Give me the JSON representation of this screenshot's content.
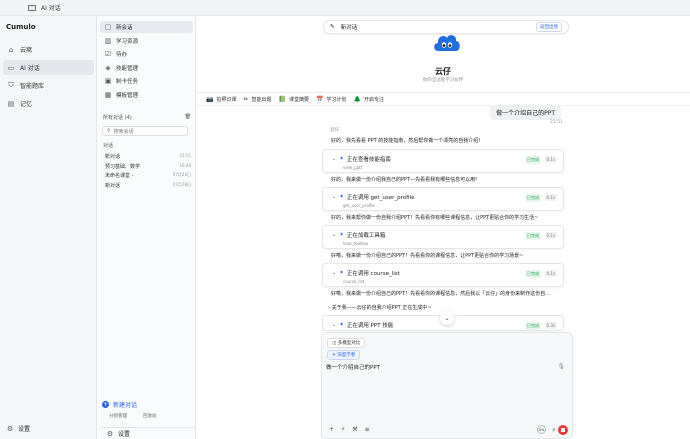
{
  "window": {
    "title": "AI 对话"
  },
  "nav": {
    "brand": "Cumulo",
    "items": [
      {
        "label": "云窝",
        "icon": "home-icon"
      },
      {
        "label": "AI 对话",
        "icon": "chat-icon"
      },
      {
        "label": "智能题库",
        "icon": "cap-icon"
      },
      {
        "label": "记忆",
        "icon": "doc-icon"
      }
    ],
    "settings": "设置"
  },
  "sidebar": {
    "items": [
      {
        "label": "新会话",
        "icon": "chat-bubble-icon"
      },
      {
        "label": "学习资源",
        "icon": "book-icon"
      },
      {
        "label": "待办",
        "icon": "checklist-icon"
      },
      {
        "label": "技能管理",
        "icon": "skill-icon"
      },
      {
        "label": "制卡任务",
        "icon": "card-icon"
      },
      {
        "label": "模板管理",
        "icon": "template-icon"
      }
    ],
    "all_conversations": "所有对话 (4)",
    "search_placeholder": "搜索会话",
    "group": "对话",
    "conversations": [
      {
        "title": "新对话",
        "time": "21:51"
      },
      {
        "title": "预习基础、数学",
        "time": "16:49"
      },
      {
        "title": "未命名课堂 -",
        "time": "07月28日"
      },
      {
        "title": "新对话",
        "time": "07月28日"
      }
    ],
    "new_chat": "新建对话",
    "footer_left": "分组管理",
    "footer_right": "回收站",
    "settings": "设置"
  },
  "main": {
    "title": "新对话",
    "back_button": "返回出他",
    "bot_name": "云仔",
    "bot_subtitle": "你的全过程学习伙伴",
    "quick_actions": [
      {
        "label": "拍照识课",
        "icon": "camera-icon"
      },
      {
        "label": "智能出题",
        "icon": "pencil-icon"
      },
      {
        "label": "课堂摘要",
        "icon": "notes-icon"
      },
      {
        "label": "学习计划",
        "icon": "calendar-icon"
      },
      {
        "label": "开启专注",
        "icon": "tree-icon"
      }
    ],
    "user_message": "做一个介绍自己的PPT",
    "user_time": "21:51",
    "assistant_label": "云仔",
    "messages": [
      "好的，我先看看 PPT 的技能指南，然后帮你做一个漂亮的自我介绍!",
      "好的，我来做一份介绍我自己的PPT—先看看我有哪些信息可以用!",
      "好的，我来帮你做一份自我介绍PPT！先看看你有哪些课程信息，让PPT更贴合你的学习生活~",
      "好嘞，我来做一份介绍自己的PPT！先看看你的课程信息，让PPT更贴合你的学习场景~",
      "好嘞，我来做一份介绍自己的PPT！先看看你的课程信息，然后我以「云仔」的身份来制作这份自...",
      "关于我——云仔的自我介绍PPT 正在生成中~"
    ],
    "tools": [
      {
        "name": "正在查看技能指南",
        "sub": "view_pptf",
        "status": "已完成",
        "duration": "0.1s"
      },
      {
        "name": "正在调用 get_user_profile",
        "sub": "get_user_profile",
        "status": "已完成",
        "duration": "0.1s"
      },
      {
        "name": "正在加载工具箱",
        "sub": "load_toolbox",
        "status": "已完成",
        "duration": "0.1s"
      },
      {
        "name": "正在调用 course_list",
        "sub": "course_list",
        "status": "已完成",
        "duration": "0.1s"
      },
      {
        "name": "正在调用 PPT 技能",
        "sub": "create_pptx",
        "status": "已完成",
        "duration": "0.3s"
      }
    ],
    "composer": {
      "model_chip": "多模型对比",
      "think_chip": "深度学者",
      "text": "做一个介绍自己的PPT",
      "usage": "0%"
    }
  }
}
